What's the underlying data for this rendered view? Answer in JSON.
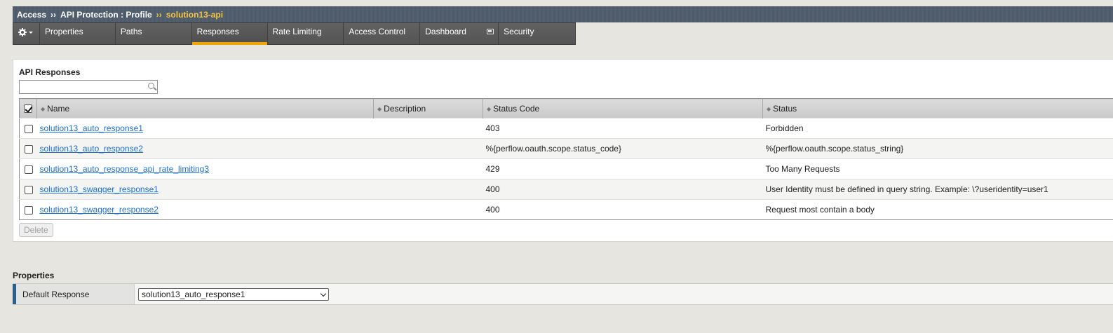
{
  "breadcrumb": {
    "root": "Access",
    "section": "API Protection : Profile",
    "current": "solution13-api",
    "separator": "››"
  },
  "tabs": [
    {
      "label": "Properties",
      "active": false
    },
    {
      "label": "Paths",
      "active": false
    },
    {
      "label": "Responses",
      "active": true
    },
    {
      "label": "Rate Limiting",
      "active": false
    },
    {
      "label": "Access Control",
      "active": false
    },
    {
      "label": "Dashboard",
      "active": false
    },
    {
      "label": "Security",
      "active": false
    }
  ],
  "responses": {
    "title": "API Responses",
    "search_value": "",
    "columns": [
      "Name",
      "Description",
      "Status Code",
      "Status"
    ],
    "rows": [
      {
        "name": "solution13_auto_response1",
        "description": "",
        "status_code": "403",
        "status": "Forbidden"
      },
      {
        "name": "solution13_auto_response2",
        "description": "",
        "status_code": "%{perflow.oauth.scope.status_code}",
        "status": "%{perflow.oauth.scope.status_string}"
      },
      {
        "name": "solution13_auto_response_api_rate_limiting3",
        "description": "",
        "status_code": "429",
        "status": "Too Many Requests"
      },
      {
        "name": "solution13_swagger_response1",
        "description": "",
        "status_code": "400",
        "status": "User Identity must be defined in query string. Example: \\?useridentity=user1"
      },
      {
        "name": "solution13_swagger_response2",
        "description": "",
        "status_code": "400",
        "status": "Request most contain a body"
      }
    ],
    "delete_label": "Delete"
  },
  "properties": {
    "title": "Properties",
    "default_response_label": "Default Response",
    "default_response_value": "solution13_auto_response1"
  },
  "colors": {
    "topbar": "#4e5b6b",
    "accent": "#f0a800",
    "link": "#1b6ed6"
  }
}
